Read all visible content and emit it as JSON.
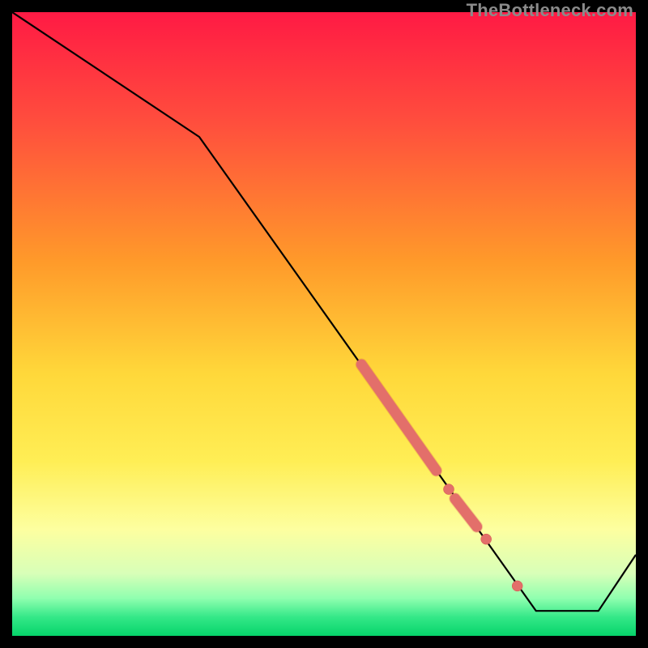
{
  "watermark": "TheBottleneck.com",
  "colors": {
    "background": "#000000",
    "line": "#000000",
    "marker_fill": "#e36f6a",
    "marker_stroke": "#d34f49",
    "gradient_top": "#ff1a44",
    "gradient_mid_upper": "#ff8a2a",
    "gradient_mid": "#ffe83a",
    "gradient_mid_lower": "#faff9a",
    "gradient_band_pale": "#b8ffc0",
    "gradient_band_green": "#22e57a",
    "gradient_bottom": "#00e676"
  },
  "chart_data": {
    "type": "line",
    "title": "",
    "xlabel": "",
    "ylabel": "",
    "xlim": [
      0,
      100
    ],
    "ylim": [
      0,
      100
    ],
    "note": "No axes or tick labels are rendered in the source image; values are estimated from pixel positions on a 0–100 normalized grid. Higher y = higher on the chart.",
    "series": [
      {
        "name": "curve",
        "x": [
          0,
          30,
          84,
          94,
          100
        ],
        "y": [
          100,
          80,
          4,
          4,
          13
        ]
      }
    ],
    "markers": [
      {
        "name": "segment-cluster-top",
        "shape": "thick-segment",
        "x": [
          56,
          68
        ],
        "y": [
          43.5,
          26.5
        ]
      },
      {
        "name": "dot-1",
        "shape": "dot",
        "x": 70,
        "y": 23.5
      },
      {
        "name": "segment-cluster-mid",
        "shape": "thick-segment",
        "x": [
          71,
          74.5
        ],
        "y": [
          22,
          17.5
        ]
      },
      {
        "name": "dot-2",
        "shape": "dot",
        "x": 76,
        "y": 15.5
      },
      {
        "name": "dot-3",
        "shape": "dot",
        "x": 81,
        "y": 8
      }
    ]
  }
}
